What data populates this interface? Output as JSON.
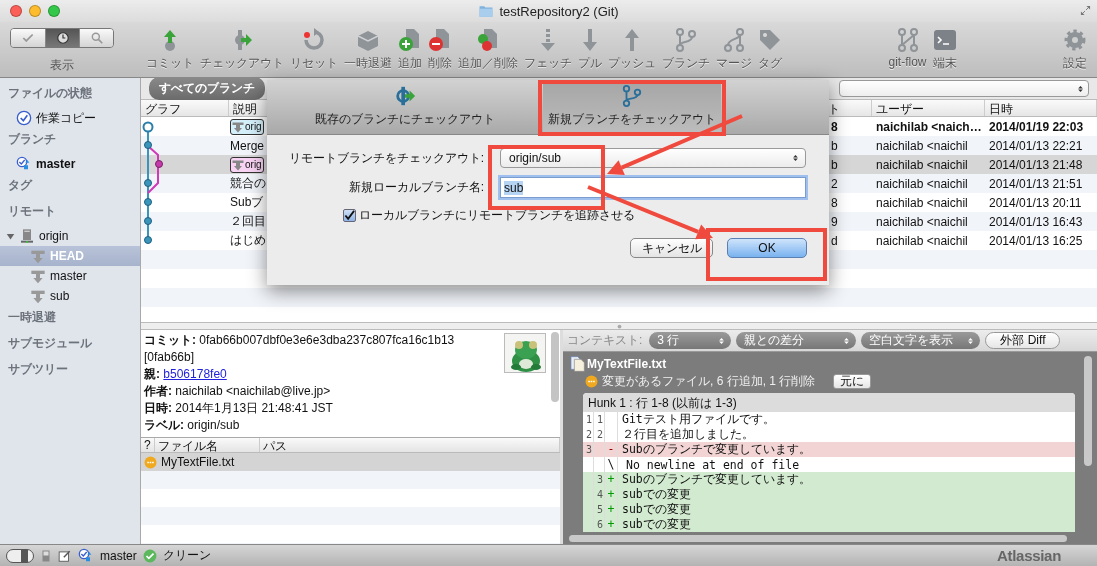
{
  "window": {
    "title": "testRepository2 (Git)"
  },
  "toolbar": {
    "view": {
      "label": "表示",
      "segments": [
        {
          "selected": false
        },
        {
          "selected": true
        },
        {
          "selected": false
        }
      ]
    },
    "actions": [
      {
        "label": "コミット"
      },
      {
        "label": "チェックアウト"
      },
      {
        "label": "リセット"
      },
      {
        "label": "一時退避"
      },
      {
        "label": "追加"
      },
      {
        "label": "削除"
      },
      {
        "label": "追加／削除"
      },
      {
        "label": "フェッチ"
      },
      {
        "label": "プル"
      },
      {
        "label": "プッシュ"
      },
      {
        "label": "ブランチ"
      },
      {
        "label": "マージ"
      },
      {
        "label": "タグ"
      }
    ],
    "tools": [
      {
        "label": "git-flow"
      },
      {
        "label": "端末"
      }
    ],
    "settings": {
      "label": "設定"
    }
  },
  "sidebar": {
    "sections": [
      {
        "title": "ファイルの状態",
        "items": [
          {
            "label": "作業コピー",
            "kind": "status",
            "selected": false,
            "current": false
          }
        ]
      },
      {
        "title": "ブランチ",
        "items": [
          {
            "label": "master",
            "kind": "branch",
            "selected": false,
            "current": true
          }
        ]
      },
      {
        "title": "タグ"
      },
      {
        "title": "リモート",
        "items": [
          {
            "label": "origin",
            "kind": "remote",
            "selected": false,
            "current": false,
            "expanded": true,
            "children": [
              {
                "label": "HEAD",
                "kind": "remote-branch",
                "selected": true,
                "current": false
              },
              {
                "label": "master",
                "kind": "remote-branch",
                "selected": false,
                "current": false
              },
              {
                "label": "sub",
                "kind": "remote-branch",
                "selected": false,
                "current": false
              }
            ]
          }
        ]
      },
      {
        "title": "一時退避"
      },
      {
        "title": "サブモジュール"
      },
      {
        "title": "サブツリー"
      }
    ]
  },
  "history": {
    "filter": "すべてのブランチ",
    "columns": [
      "グラフ",
      "説明",
      "ト",
      "ユーザー",
      "日時"
    ],
    "rows": [
      {
        "label": {
          "text": "orig",
          "color": "#d4effa"
        },
        "column_3": "8",
        "user": "naichilab <naich…",
        "date": "2014/01/19 22:03",
        "current": true,
        "selected": false
      },
      {
        "description": "Merge",
        "column_3": "b",
        "user": "naichilab <naichil",
        "date": "2014/01/13 22:21",
        "current": false,
        "selected": false
      },
      {
        "label": {
          "text": "orig",
          "color": "#f8d3f3"
        },
        "column_3": "b",
        "user": "naichilab <naichil",
        "date": "2014/01/13 21:48",
        "current": false,
        "selected": true
      },
      {
        "description": "競合の",
        "column_3": "2",
        "user": "naichilab <naichil",
        "date": "2014/01/13 21:51",
        "current": false,
        "selected": false
      },
      {
        "description": "Subブ",
        "column_3": "8",
        "user": "naichilab <naichil",
        "date": "2014/01/13 20:11",
        "current": false,
        "selected": false
      },
      {
        "description": "２回目",
        "column_3": "9",
        "user": "naichilab <naichil",
        "date": "2014/01/13 16:43",
        "current": false,
        "selected": false
      },
      {
        "description": "はじめ",
        "column_3": "d",
        "user": "naichilab <naichil",
        "date": "2014/01/13 16:25",
        "current": false,
        "selected": false
      }
    ]
  },
  "dialog": {
    "tabs": [
      {
        "label": "既存のブランチにチェックアウト",
        "selected": false
      },
      {
        "label": "新規ブランチをチェックアウト",
        "selected": true
      }
    ],
    "remote_branch": {
      "label": "リモートブランチをチェックアウト:",
      "value": "origin/sub"
    },
    "local_name": {
      "label": "新規ローカルブランチ名:",
      "value": "sub"
    },
    "track": {
      "label": "ローカルブランチにリモートブランチを追跡させる",
      "checked": true
    },
    "buttons": [
      {
        "label": "キャンセル",
        "default": false
      },
      {
        "label": "OK",
        "default": true
      }
    ]
  },
  "annotations": [
    {
      "kind": "box"
    },
    {
      "kind": "box"
    },
    {
      "kind": "box"
    },
    {
      "kind": "arrow"
    },
    {
      "kind": "arrow"
    }
  ],
  "details": {
    "fields": [
      {
        "label": "コミット:",
        "value": "0fab66b007dbf0e3e6e3dba237c807fca16c1b13 [0fab66b]",
        "kind": "text"
      },
      {
        "label": "親:",
        "value": "b506178fe0",
        "kind": "link"
      },
      {
        "label": "作者:",
        "value": "naichilab <naichilab@live.jp>",
        "kind": "text"
      },
      {
        "label": "日時:",
        "value": "2014年1月13日 21:48:41 JST",
        "kind": "text"
      },
      {
        "label": "ラベル:",
        "value": "origin/sub",
        "kind": "text"
      }
    ]
  },
  "files": {
    "columns": [
      "?",
      "ファイル名",
      "パス"
    ],
    "rows": [
      {
        "kind": "modified",
        "name": "MyTextFile.txt",
        "selected": true
      }
    ]
  },
  "diff": {
    "context_label": "コンテキスト:",
    "selects": [
      "3 行",
      "親との差分",
      "空白文字を表示"
    ],
    "external_button": "外部 Diff",
    "file": {
      "name": "MyTextFile.txt",
      "kind": "modified",
      "summary": "変更があるファイル, 6 行追加, 1 行削除",
      "revert": "元に"
    },
    "hunk": {
      "title": "Hunk 1 : 行 1-8 (以前は 1-3)",
      "lines": [
        {
          "kind": "context",
          "old": "1",
          "new": "1",
          "text": "Gitテスト用ファイルです。"
        },
        {
          "kind": "context",
          "old": "2",
          "new": "2",
          "text": "２行目を追加しました。"
        },
        {
          "kind": "removed",
          "old": "3",
          "sign": "-",
          "text": "Subのブランチで変更しています。"
        },
        {
          "kind": "note",
          "sign": "\\",
          "text": "No newline at end of file"
        },
        {
          "kind": "added",
          "new": "3",
          "sign": "+",
          "text": "Subのブランチで変更しています。"
        },
        {
          "kind": "added",
          "new": "4",
          "sign": "+",
          "text": "subでの変更"
        },
        {
          "kind": "added",
          "new": "5",
          "sign": "+",
          "text": "subでの変更"
        },
        {
          "kind": "added",
          "new": "6",
          "sign": "+",
          "text": "subでの変更"
        }
      ]
    }
  },
  "status_bar": {
    "sidebar_visible": true,
    "branch": "master",
    "state": "クリーン",
    "logo": "Atlassian"
  }
}
